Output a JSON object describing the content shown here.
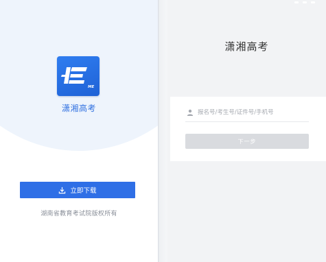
{
  "download_page": {
    "app_name": "潇湘高考",
    "logo_text": "ME",
    "download_label": "立即下载",
    "copyright": "湖南省教育考试院版权所有"
  },
  "login_page": {
    "title": "潇湘高考",
    "id_placeholder": "报名号/考生号/证件号/手机号",
    "next_label": "下一步"
  },
  "colors": {
    "brand_blue": "#2f6fe6",
    "light_bg_circle": "#eef4fc",
    "disabled_button": "#d9dbdf"
  },
  "icons": {
    "logo": "app-logo-icon",
    "download": "download-icon",
    "user": "user-icon"
  }
}
